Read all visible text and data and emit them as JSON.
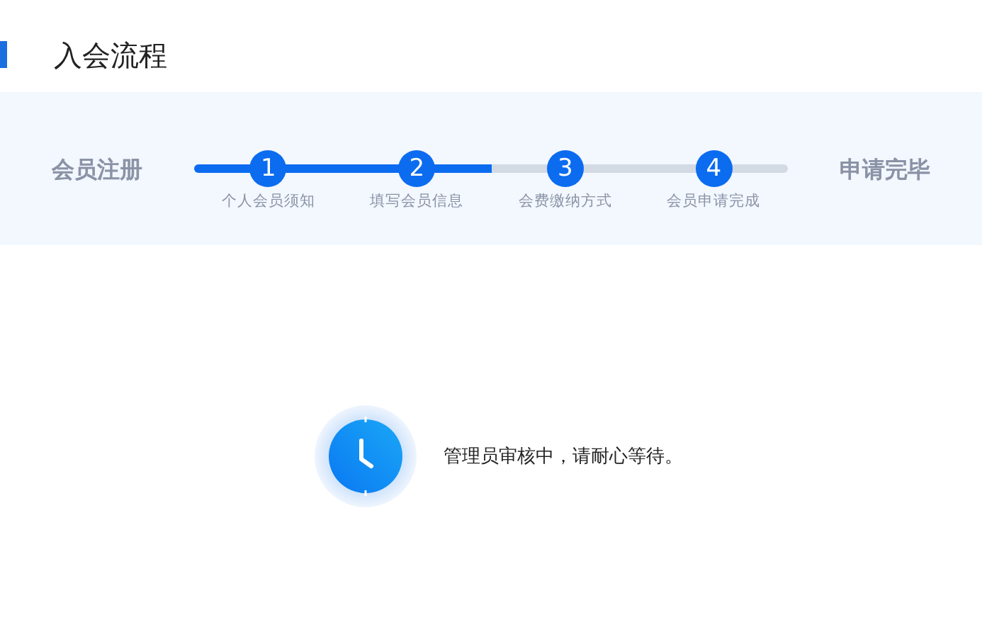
{
  "page_title": "入会流程",
  "progress": {
    "start_label": "会员注册",
    "end_label": "申请完毕",
    "steps": [
      {
        "number": "1",
        "label": "个人会员须知",
        "completed": true
      },
      {
        "number": "2",
        "label": "填写会员信息",
        "completed": true
      },
      {
        "number": "3",
        "label": "会费缴纳方式",
        "completed": false
      },
      {
        "number": "4",
        "label": "会员申请完成",
        "completed": false
      }
    ]
  },
  "status": {
    "message": "管理员审核中，请耐心等待。"
  }
}
